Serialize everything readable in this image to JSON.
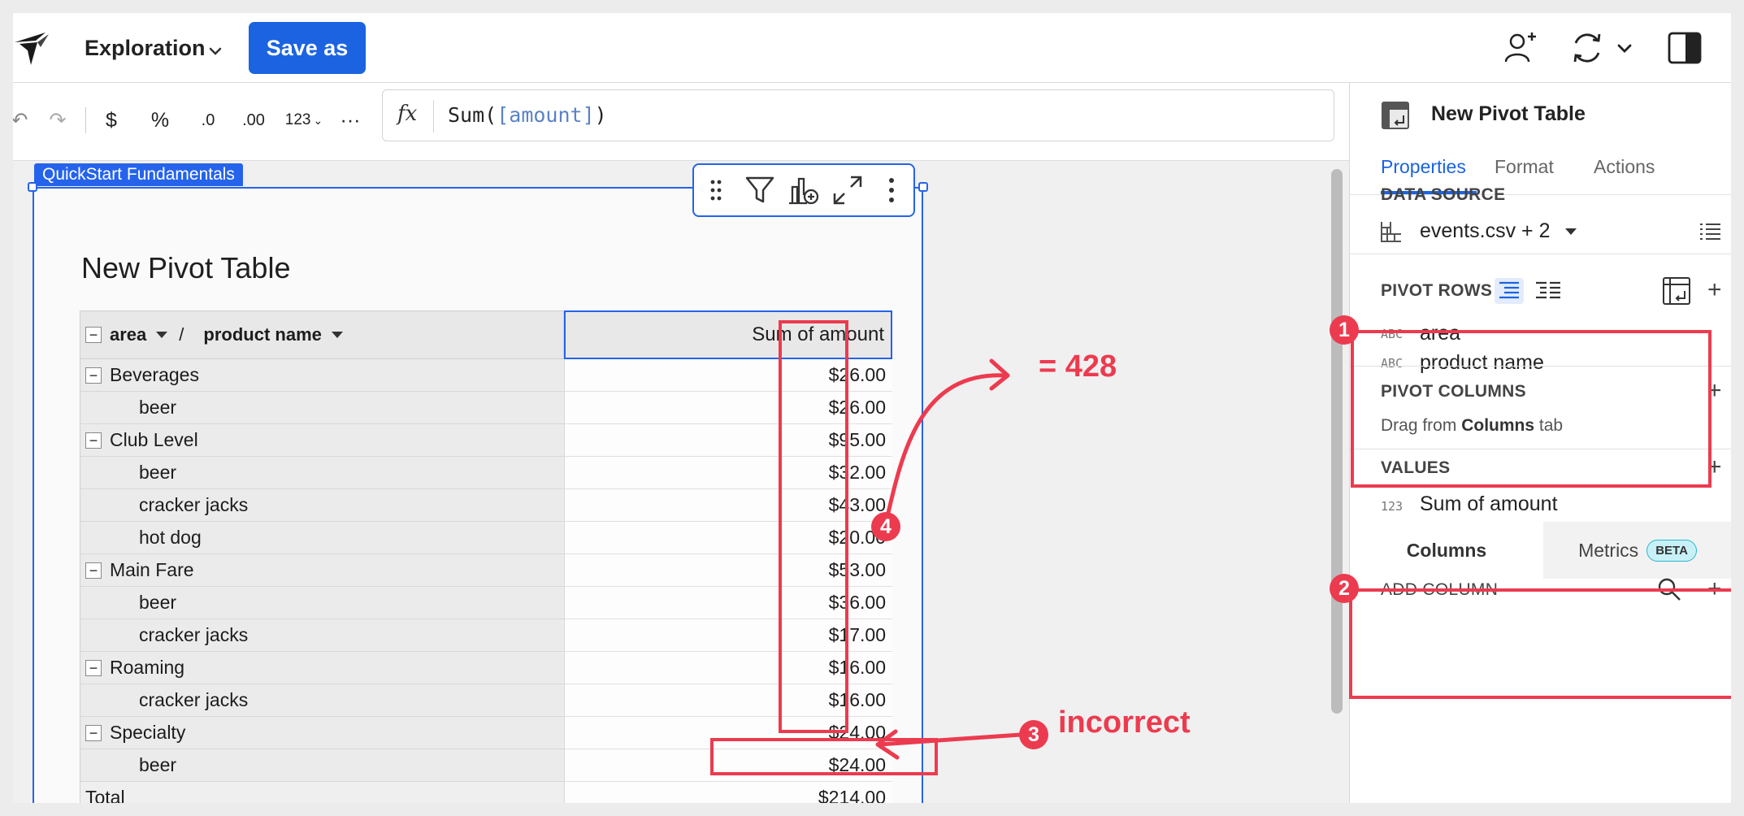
{
  "header": {
    "doc_title": "Exploration",
    "save_as_label": "Save as"
  },
  "formula_toolbar": {
    "buttons": {
      "undo": "↶",
      "redo": "↷",
      "currency": "$",
      "percent": "%",
      "decrease_decimals": ".0",
      "increase_decimals": ".00",
      "number_format": "123",
      "more": "···"
    },
    "fx_symbol": "fx",
    "formula_prefix": "Sum(",
    "formula_arg": "[amount]",
    "formula_suffix": ")"
  },
  "canvas": {
    "workspace_tag": "QuickStart Fundamentals",
    "element_title": "New Pivot Table"
  },
  "pivot": {
    "row_header_1": "area",
    "row_header_sep": "/",
    "row_header_2": "product name",
    "value_header": "Sum of amount",
    "rows": [
      {
        "label": "Beverages",
        "value": "$26.00",
        "group": true
      },
      {
        "label": "beer",
        "value": "$26.00",
        "group": false
      },
      {
        "label": "Club Level",
        "value": "$95.00",
        "group": true
      },
      {
        "label": "beer",
        "value": "$32.00",
        "group": false
      },
      {
        "label": "cracker jacks",
        "value": "$43.00",
        "group": false
      },
      {
        "label": "hot dog",
        "value": "$20.00",
        "group": false
      },
      {
        "label": "Main Fare",
        "value": "$53.00",
        "group": true
      },
      {
        "label": "beer",
        "value": "$36.00",
        "group": false
      },
      {
        "label": "cracker jacks",
        "value": "$17.00",
        "group": false
      },
      {
        "label": "Roaming",
        "value": "$16.00",
        "group": true
      },
      {
        "label": "cracker jacks",
        "value": "$16.00",
        "group": false
      },
      {
        "label": "Specialty",
        "value": "$24.00",
        "group": true
      },
      {
        "label": "beer",
        "value": "$24.00",
        "group": false
      }
    ],
    "total_label": "Total",
    "total_value": "$214.00"
  },
  "annotations": {
    "badge_1": "1",
    "badge_2": "2",
    "badge_3": "3",
    "badge_4": "4",
    "sum_note": "= 428",
    "incorrect_note": "incorrect",
    "color": "#ec3b4f"
  },
  "panel": {
    "title": "New Pivot Table",
    "tabs": [
      "Properties",
      "Format",
      "Actions"
    ],
    "active_tab": "Properties",
    "data_source_label": "DATA SOURCE",
    "data_source_value": "events.csv + 2",
    "pivot_rows_label": "PIVOT ROWS",
    "pivot_rows": [
      {
        "type": "ABC",
        "name": "area"
      },
      {
        "type": "ABC",
        "name": "product name"
      }
    ],
    "pivot_columns_label": "PIVOT COLUMNS",
    "pivot_columns_hint_prefix": "Drag from",
    "pivot_columns_hint_bold": "Columns",
    "pivot_columns_hint_suffix": "tab",
    "values_label": "VALUES",
    "values": [
      {
        "type": "123",
        "name": "Sum of amount"
      }
    ],
    "bottom_tab_columns": "Columns",
    "bottom_tab_metrics": "Metrics",
    "beta_badge": "BETA",
    "add_column_label": "ADD COLUMN"
  },
  "colors": {
    "accent": "#1b63e0",
    "selection": "#2563eb"
  }
}
